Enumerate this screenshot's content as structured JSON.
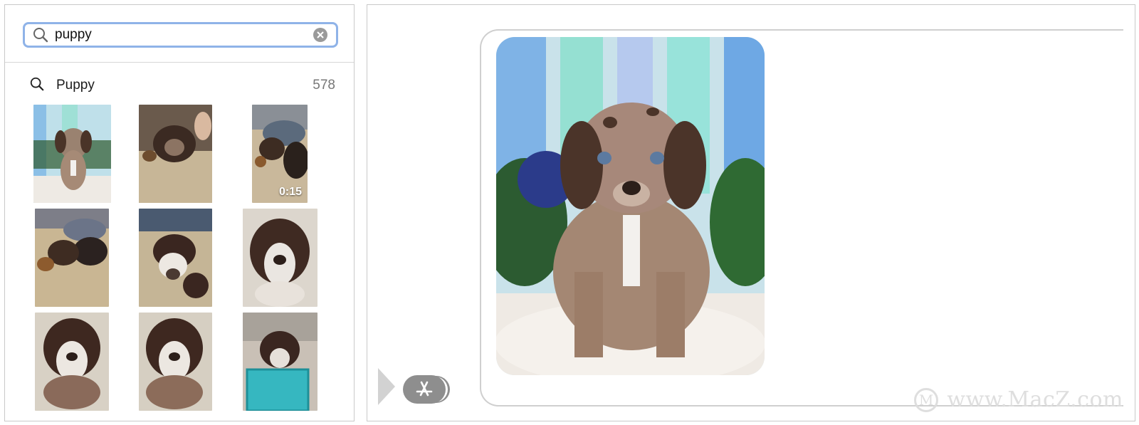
{
  "search": {
    "value": "puppy",
    "placeholder": "Search"
  },
  "results": {
    "label": "Puppy",
    "count": "578"
  },
  "thumbnails": {
    "video_duration": "0:15"
  },
  "icons": {
    "search": "search-icon",
    "clear": "clear-icon",
    "expand": "expand-arrow-icon",
    "apps": "app-store-icon"
  },
  "watermark": {
    "text": "www.MacZ.com"
  },
  "colors": {
    "search_focus": "#8fb3e8",
    "app_button": "#8e8e8e"
  }
}
